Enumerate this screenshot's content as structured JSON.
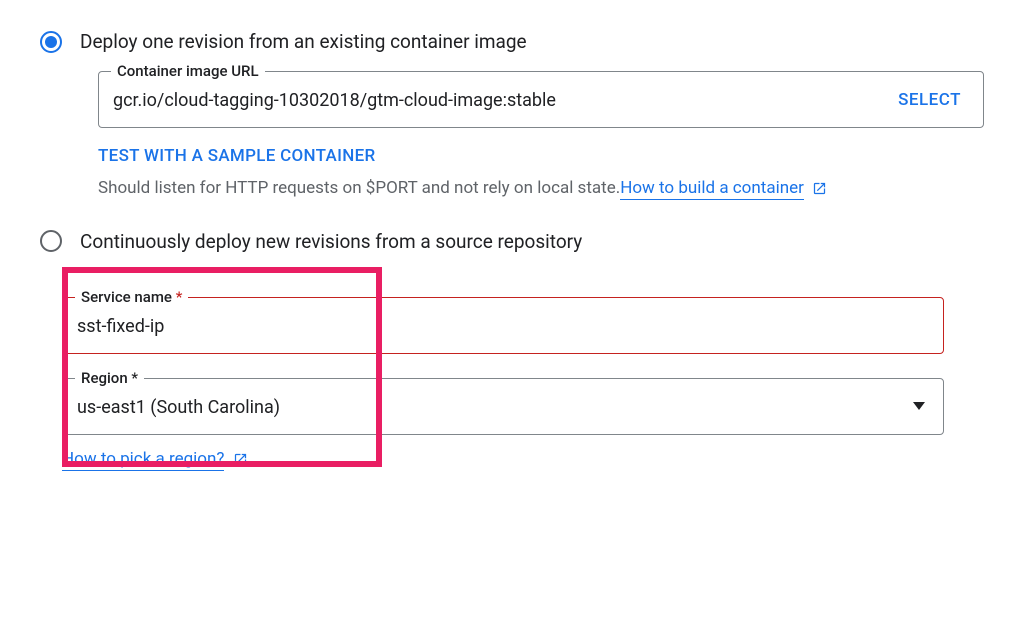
{
  "deployOptions": {
    "existingImage": "Deploy one revision from an existing container image",
    "sourceRepo": "Continuously deploy new revisions from a source repository"
  },
  "containerImage": {
    "label": "Container image URL",
    "value": "gcr.io/cloud-tagging-10302018/gtm-cloud-image:stable",
    "selectButton": "SELECT"
  },
  "testLink": "TEST WITH A SAMPLE CONTAINER",
  "helpText": "Should listen for HTTP requests on $PORT and not rely on local state.",
  "buildContainerLink": "How to build a container",
  "serviceName": {
    "label": "Service name",
    "value": "sst-fixed-ip"
  },
  "region": {
    "label": "Region",
    "value": "us-east1 (South Carolina)"
  },
  "regionHelpLink": "How to pick a region?"
}
